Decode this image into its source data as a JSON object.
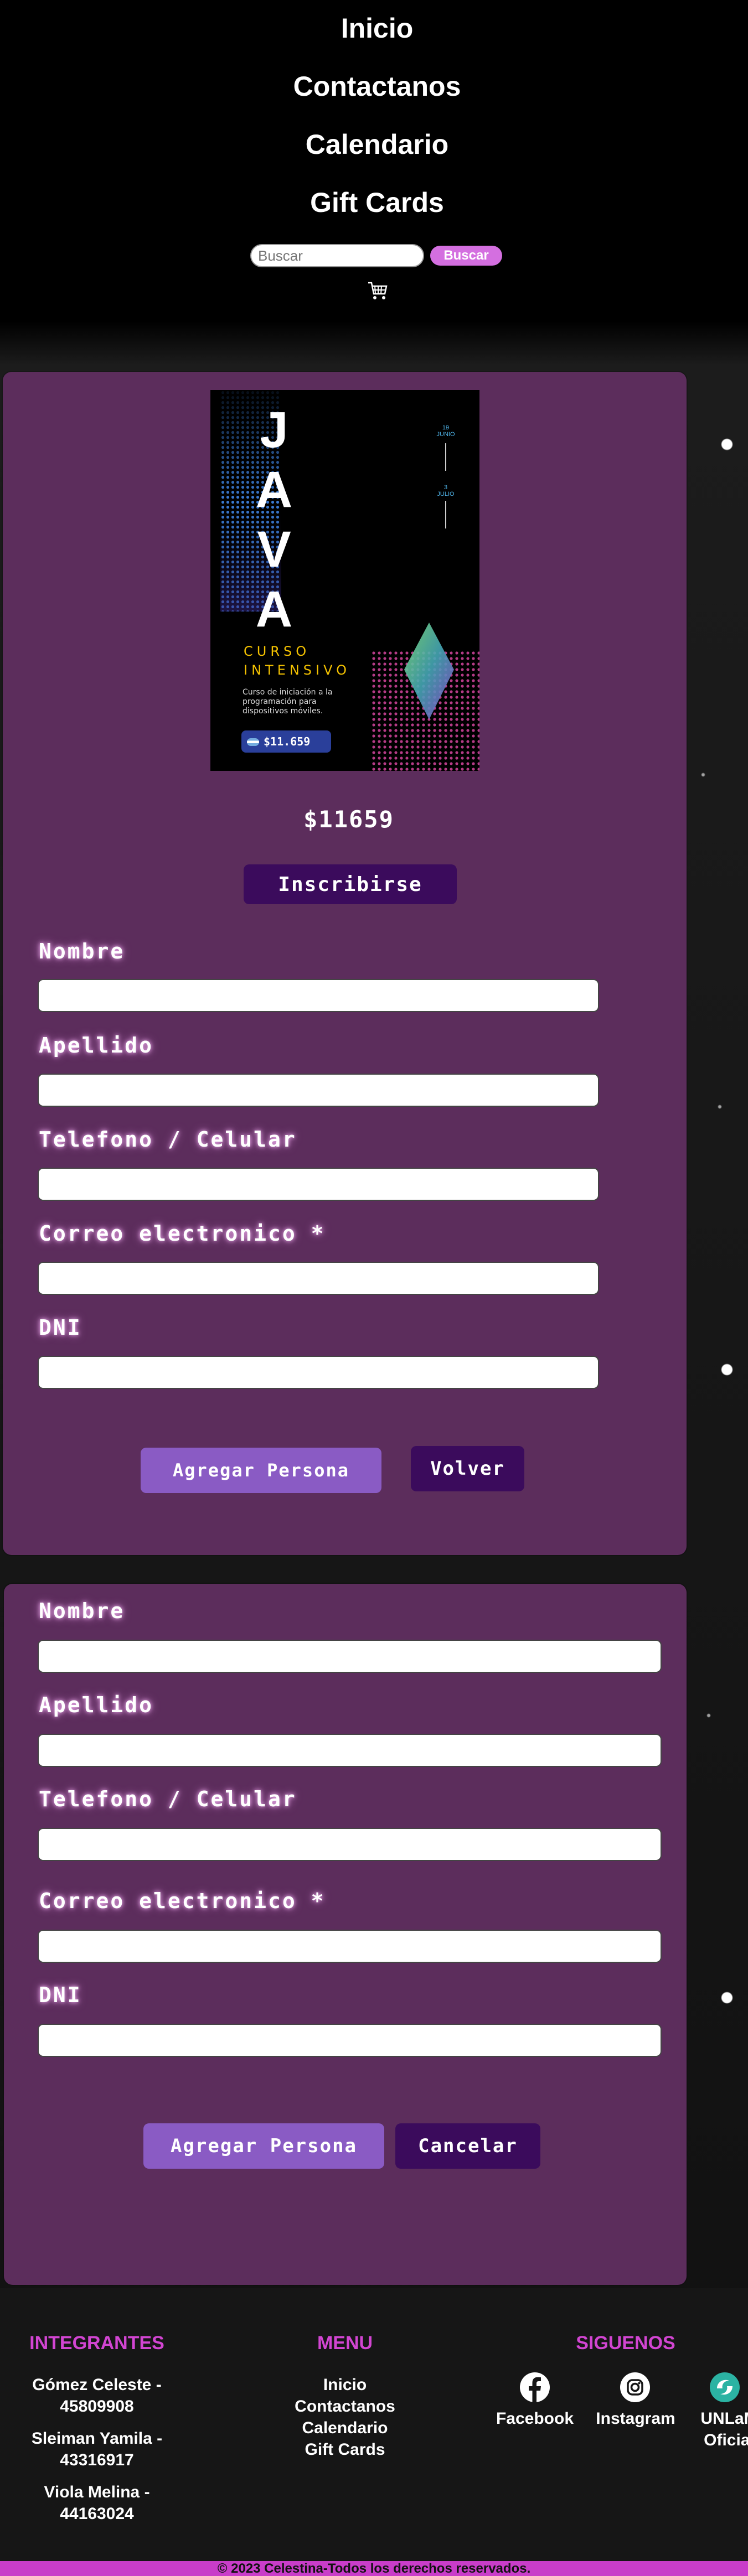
{
  "nav": {
    "links": [
      "Inicio",
      "Contactanos",
      "Calendario",
      "Gift Cards"
    ],
    "search_placeholder": "Buscar",
    "search_button": "Buscar"
  },
  "product": {
    "poster": {
      "title_letters": [
        "J",
        "A",
        "V",
        "A"
      ],
      "date_top_day": "19",
      "date_top_month": "JUNIO",
      "date_bottom_day": "3",
      "date_bottom_month": "JULIO",
      "subtitle_line1": "CURSO",
      "subtitle_line2": "INTENSIVO",
      "description": [
        "Curso de iniciación a la",
        "programación para",
        "dispositivos móviles."
      ],
      "price_tag": "$11.659"
    },
    "price": "$11659",
    "enroll_button": "Inscribirse"
  },
  "form_primary": {
    "fields": [
      {
        "label": "Nombre",
        "value": ""
      },
      {
        "label": "Apellido",
        "value": ""
      },
      {
        "label": "Telefono / Celular",
        "value": ""
      },
      {
        "label": "Correo electronico *",
        "value": ""
      },
      {
        "label": "DNI",
        "value": ""
      }
    ],
    "add_button": "Agregar Persona",
    "back_button": "Volver"
  },
  "form_extra": {
    "fields": [
      {
        "label": "Nombre",
        "value": ""
      },
      {
        "label": "Apellido",
        "value": ""
      },
      {
        "label": "Telefono / Celular",
        "value": ""
      },
      {
        "label": "Correo electronico *",
        "value": ""
      },
      {
        "label": "DNI",
        "value": ""
      }
    ],
    "add_button": "Agregar Persona",
    "cancel_button": "Cancelar"
  },
  "footer": {
    "members_title": "INTEGRANTES",
    "members": [
      "Gómez Celeste -",
      "45809908",
      "Sleiman Yamila -",
      "43316917",
      "Viola Melina -",
      "44163024"
    ],
    "menu_title": "MENU",
    "menu_links": [
      "Inicio",
      "Contactanos",
      "Calendario",
      "Gift Cards"
    ],
    "social_title": "SIGUENOS",
    "social": [
      "Facebook",
      "Instagram",
      "UNLaM",
      "Oficial"
    ],
    "copyright": "© 2023 Celestina-Todos los derechos reservados."
  },
  "colors": {
    "card": "#5c2d5c",
    "accent_pink": "#d245d2",
    "button_dark": "#3b0b5c",
    "button_light": "#8a5bc4"
  }
}
